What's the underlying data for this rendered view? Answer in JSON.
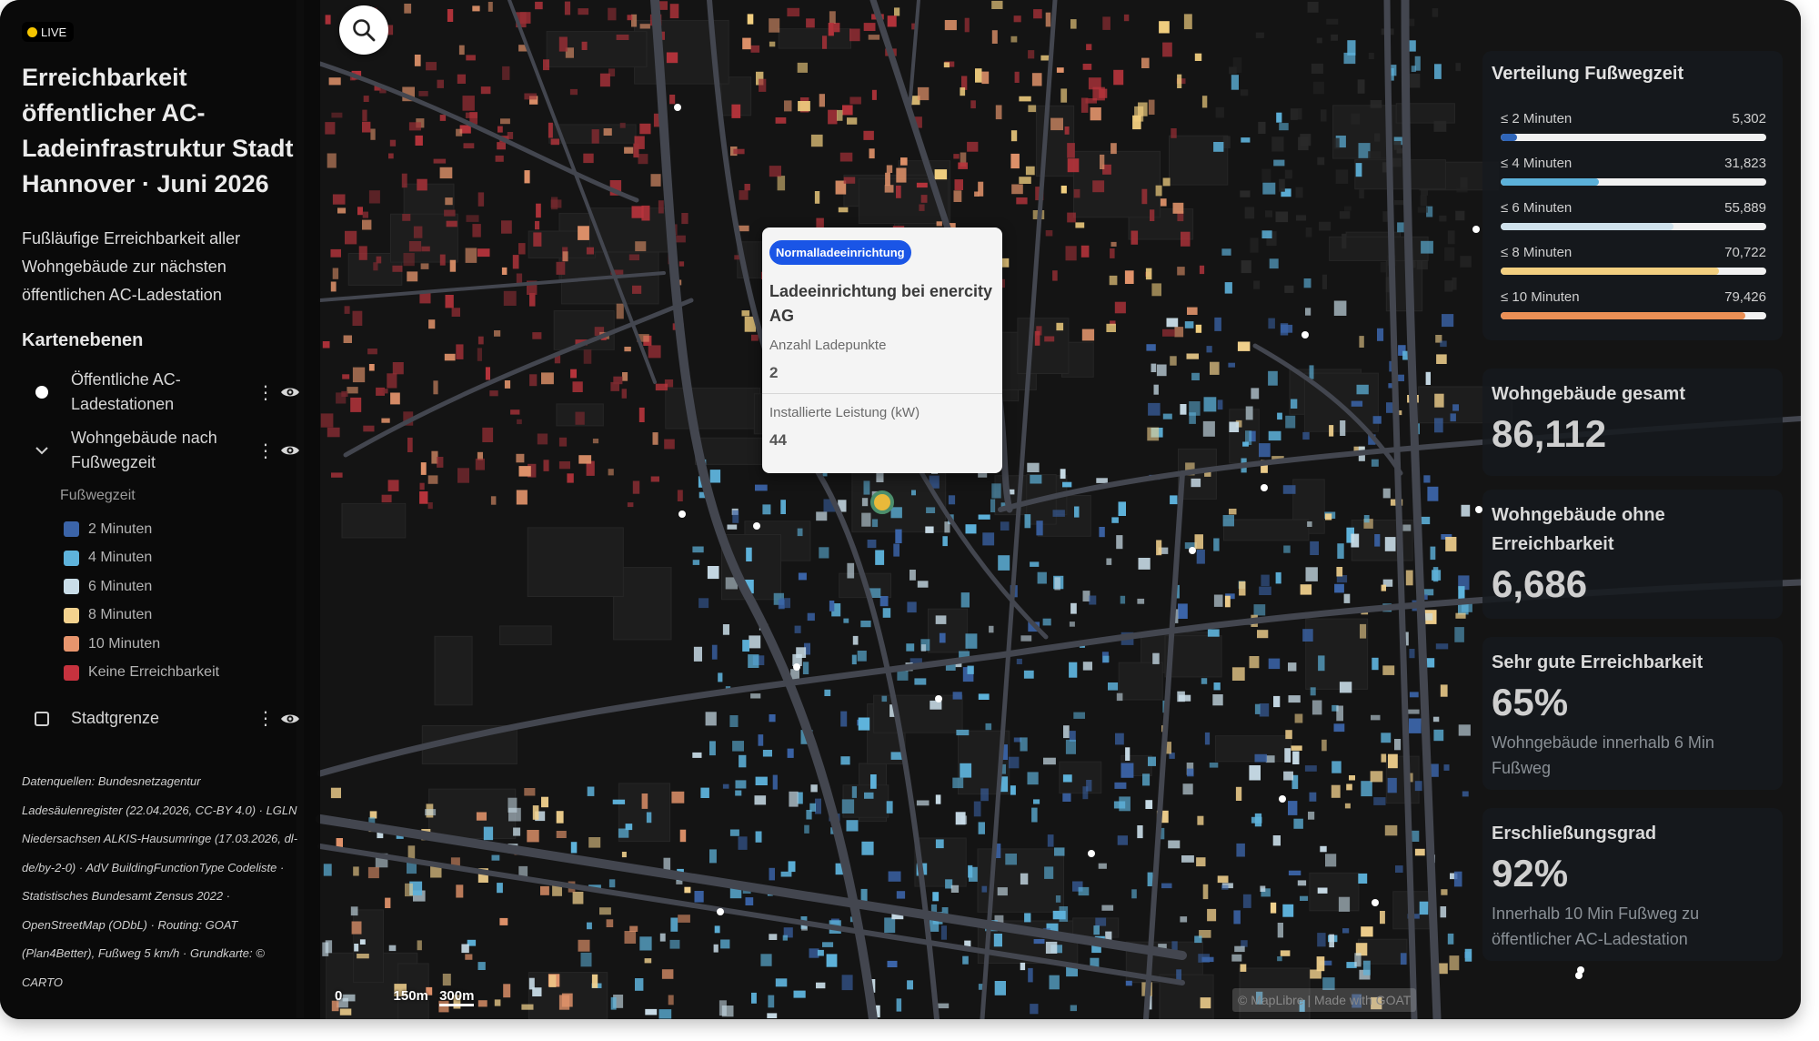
{
  "live_label": "LIVE",
  "title": "Erreichbarkeit öffentlicher AC-Ladeinfrastruktur Stadt Hannover · Juni 2026",
  "description": "Fußläufige Erreichbarkeit aller Wohngebäude zur nächsten öffentlichen AC-Ladestation",
  "layers_heading": "Kartenebenen",
  "layers": [
    {
      "label": "Öffentliche AC-Ladestationen"
    },
    {
      "label": "Wohngebäude nach Fußwegzeit"
    },
    {
      "label": "Stadtgrenze"
    }
  ],
  "legend": {
    "title": "Fußwegzeit",
    "items": [
      {
        "label": "2 Minuten",
        "color": "#3b64a8"
      },
      {
        "label": "4 Minuten",
        "color": "#5eb3dc"
      },
      {
        "label": "6 Minuten",
        "color": "#c9dde8"
      },
      {
        "label": "8 Minuten",
        "color": "#f3d28e"
      },
      {
        "label": "10 Minuten",
        "color": "#e7956d"
      },
      {
        "label": "Keine Erreichbarkeit",
        "color": "#c6323e"
      }
    ]
  },
  "sources": "Datenquellen: Bundesnetzagentur Ladesäulenregister (22.04.2026, CC-BY 4.0) · LGLN Niedersachsen ALKIS-Hausumringe (17.03.2026, dl-de/by-2-0) · AdV BuildingFunctionType Codeliste · Statistisches Bundesamt Zensus 2022 · OpenStreetMap (ODbL) · Routing: GOAT (Plan4Better), Fußweg 5 km/h · Grundkarte: © CARTO",
  "popup": {
    "badge": "Normalladeeinrichtung",
    "name": "Ladeeinrichtung bei enercity AG",
    "field1_label": "Anzahl Ladepunkte",
    "field1_value": "2",
    "field2_label": "Installierte Leistung (kW)",
    "field2_value": "44"
  },
  "distribution": {
    "title": "Verteilung Fußwegzeit",
    "total": 86112,
    "rows": [
      {
        "label": "≤ 2 Minuten",
        "value_text": "5,302",
        "value": 5302,
        "color": "#2f65b8"
      },
      {
        "label": "≤ 4 Minuten",
        "value_text": "31,823",
        "value": 31823,
        "color": "#5cb1d9"
      },
      {
        "label": "≤ 6 Minuten",
        "value_text": "55,889",
        "value": 55889,
        "color": "#cfe1ec"
      },
      {
        "label": "≤ 8 Minuten",
        "value_text": "70,722",
        "value": 70722,
        "color": "#f2cf80"
      },
      {
        "label": "≤ 10 Minuten",
        "value_text": "79,426",
        "value": 79426,
        "color": "#ea8f55"
      }
    ]
  },
  "kpis": [
    {
      "label": "Wohngebäude gesamt",
      "value": "86,112",
      "sub": ""
    },
    {
      "label": "Wohngebäude ohne Erreichbarkeit",
      "value": "6,686",
      "sub": ""
    },
    {
      "label": "Sehr gute Erreichbarkeit",
      "value": "65%",
      "sub": "Wohngebäude innerhalb 6 Min Fußweg"
    },
    {
      "label": "Erschließungsgrad",
      "value": "92%",
      "sub": "Innerhalb 10 Min Fußweg zu öffentlicher AC-Ladestation"
    }
  ],
  "scale": {
    "zero": "0",
    "mid": "150m",
    "end": "300m"
  },
  "attribution": "© MapLibre | Made with GOAT"
}
